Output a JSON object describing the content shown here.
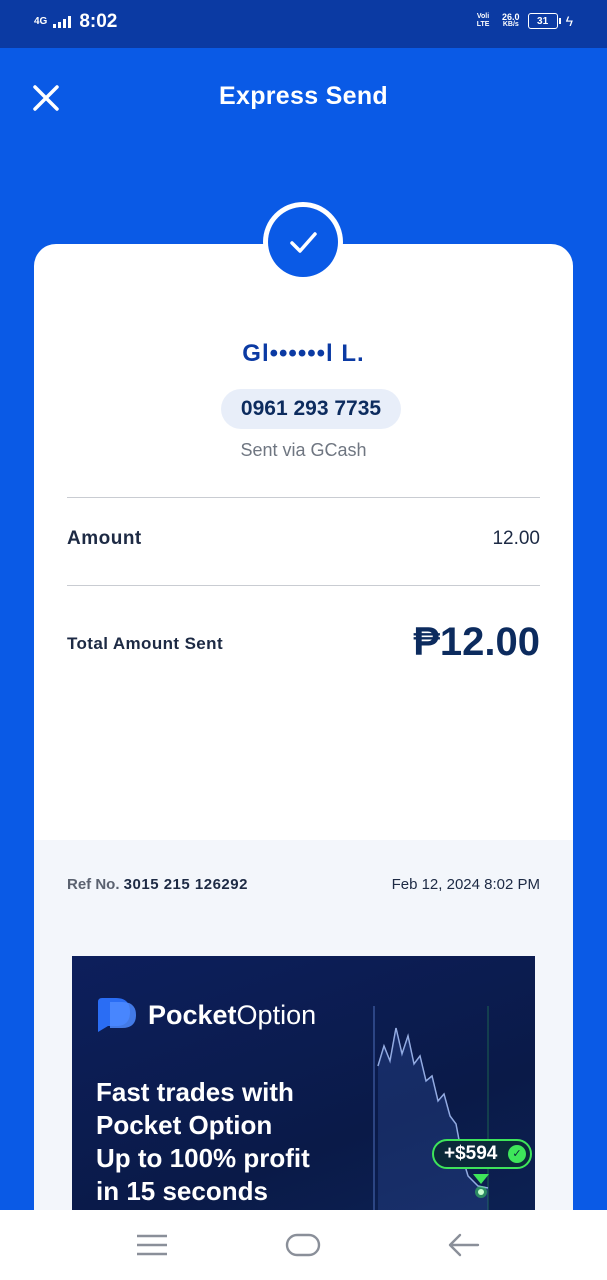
{
  "status_bar": {
    "network": "4G",
    "time": "8:02",
    "lte_label": "Voli LTE",
    "speed": "26.0",
    "speed_unit": "KB/s",
    "battery": "31"
  },
  "header": {
    "title": "Express Send"
  },
  "receipt": {
    "recipient_name": "Gl••••••l L.",
    "recipient_number": "0961 293 7735",
    "sent_via": "Sent via GCash",
    "amount_label": "Amount",
    "amount_value": "12.00",
    "total_label": "Total Amount Sent",
    "total_value": "₱12.00",
    "ref_label": "Ref No.",
    "ref_number": "3015 215 126292",
    "date": "Feb 12, 2024 8:02 PM"
  },
  "ad": {
    "brand_bold": "Pocket",
    "brand_light": "Option",
    "headline_lines": [
      "Fast trades with",
      "Pocket Option",
      "Up to 100% profit",
      "in 15 seconds"
    ],
    "profit_badge": "+$594"
  },
  "colors": {
    "primary": "#0a5ae6",
    "status_bar": "#0b3aa3",
    "text_dark": "#0c2b5e",
    "ad_green": "#3ee55a"
  }
}
